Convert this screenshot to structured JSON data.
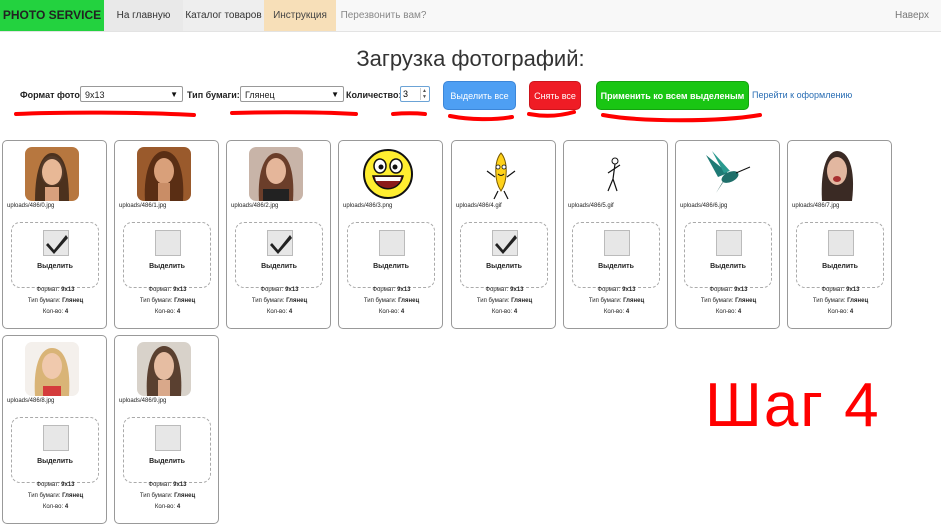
{
  "nav": {
    "brand": "PHOTO SERVICE",
    "items": [
      "На главную",
      "Каталог товаров",
      "Инструкция",
      "Перезвонить вам?"
    ],
    "top_link": "Наверх"
  },
  "page_title": "Загрузка фотографий:",
  "controls": {
    "format_label": "Формат фото:",
    "format_value": "9x13",
    "paper_label": "Тип бумаги:",
    "paper_value": "Глянец",
    "qty_label": "Количество:",
    "qty_value": "3",
    "select_all": "Выделить все",
    "deselect_all": "Снять все",
    "apply_all": "Применить ко всем выделеным",
    "checkout_link": "Перейти к оформлению"
  },
  "card_labels": {
    "select": "Выделить",
    "format": "Формат:",
    "paper": "Тип бумаги:",
    "qty": "Кол-во:"
  },
  "cards": [
    {
      "file": "uploads/486/0.jpg",
      "checked": true,
      "format": "9x13",
      "paper": "Глянец",
      "qty": "4"
    },
    {
      "file": "uploads/486/1.jpg",
      "checked": false,
      "format": "9x13",
      "paper": "Глянец",
      "qty": "4"
    },
    {
      "file": "uploads/486/2.jpg",
      "checked": true,
      "format": "9x13",
      "paper": "Глянец",
      "qty": "4"
    },
    {
      "file": "uploads/486/3.png",
      "checked": false,
      "format": "9x13",
      "paper": "Глянец",
      "qty": "4"
    },
    {
      "file": "uploads/486/4.gif",
      "checked": true,
      "format": "9x13",
      "paper": "Глянец",
      "qty": "4"
    },
    {
      "file": "uploads/486/5.gif",
      "checked": false,
      "format": "9x13",
      "paper": "Глянец",
      "qty": "4"
    },
    {
      "file": "uploads/486/6.jpg",
      "checked": false,
      "format": "9x13",
      "paper": "Глянец",
      "qty": "4"
    },
    {
      "file": "uploads/486/7.jpg",
      "checked": false,
      "format": "9x13",
      "paper": "Глянец",
      "qty": "4"
    },
    {
      "file": "uploads/486/8.jpg",
      "checked": false,
      "format": "9x13",
      "paper": "Глянец",
      "qty": "4"
    },
    {
      "file": "uploads/486/9.jpg",
      "checked": false,
      "format": "9x13",
      "paper": "Глянец",
      "qty": "4"
    }
  ],
  "annotation": "Шаг 4",
  "colors": {
    "brand": "#23d23f",
    "annotation": "#ff0000",
    "select_all": "#4e9ff3",
    "deselect_all": "#ef1c25",
    "apply_all": "#19c613"
  }
}
